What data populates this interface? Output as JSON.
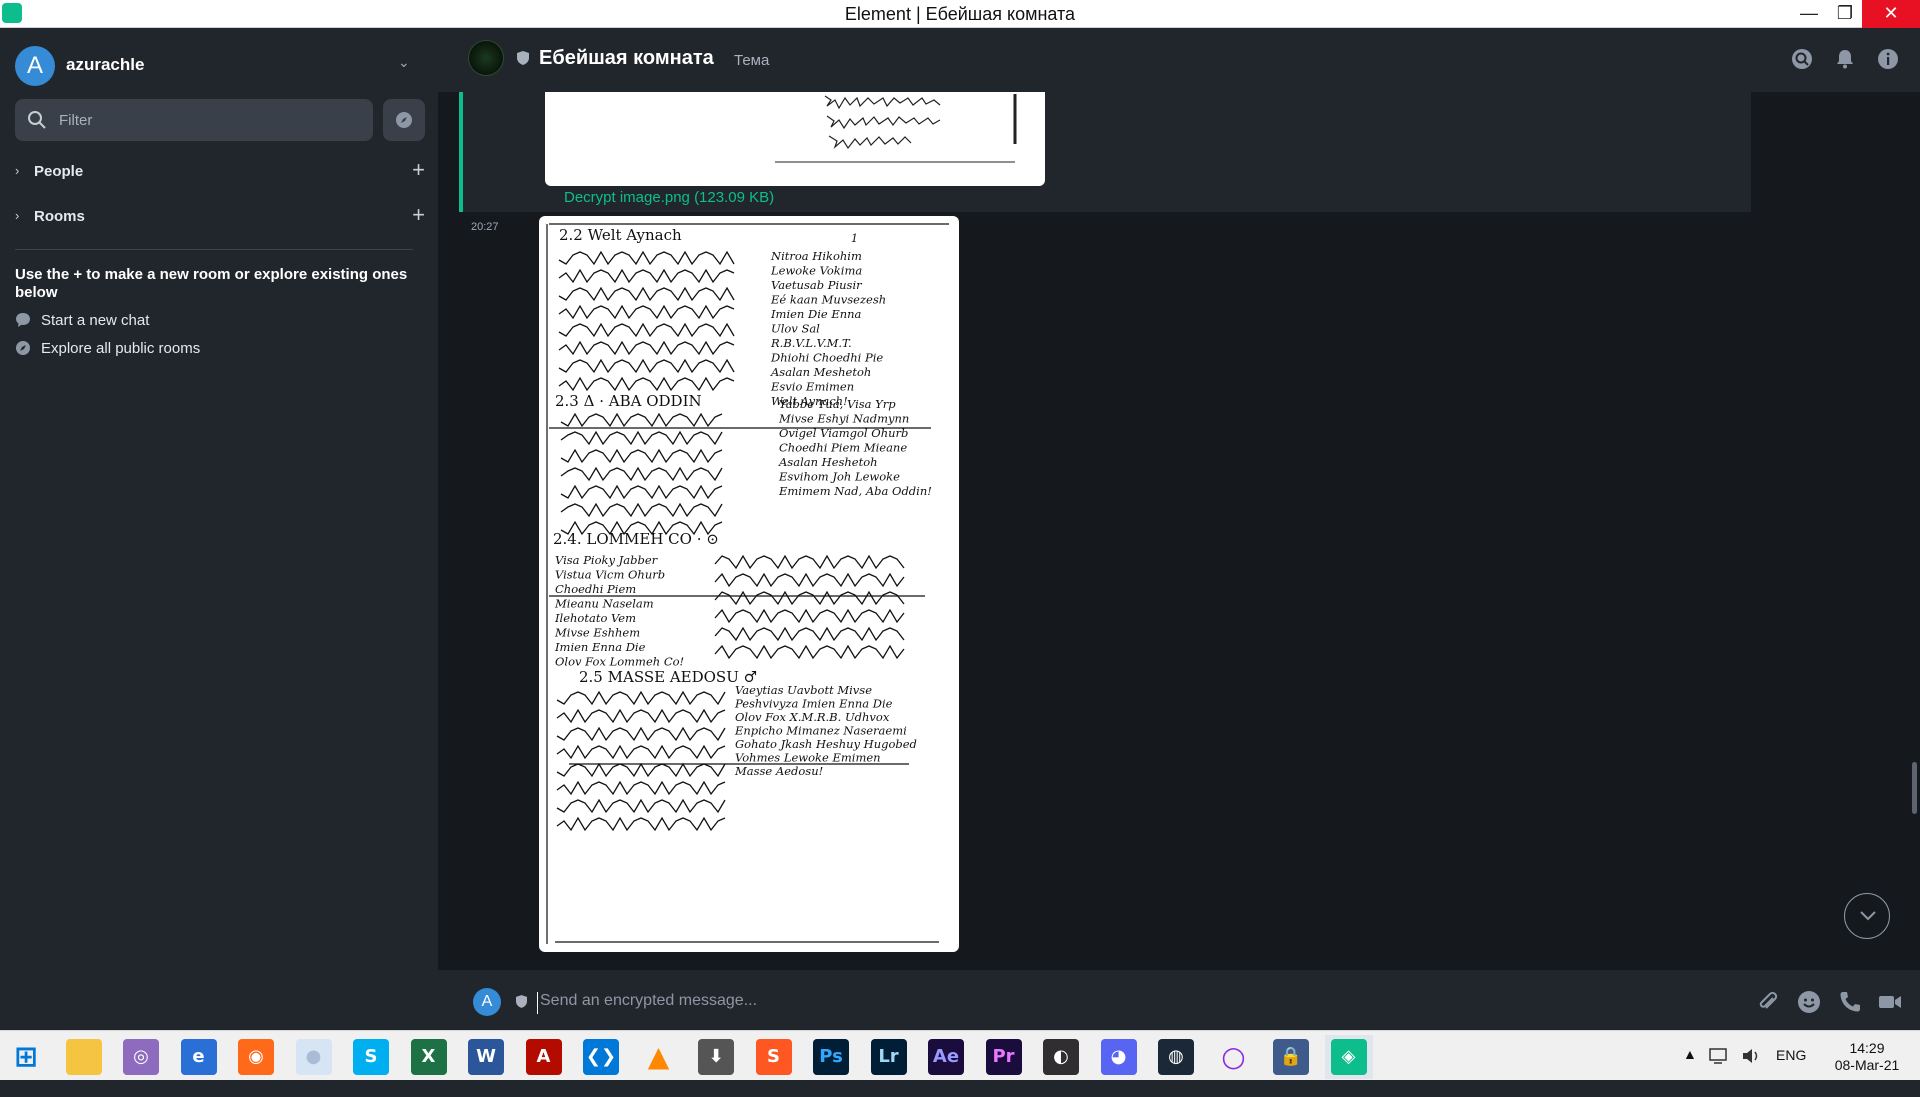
{
  "window": {
    "title": "Element | Ебейшая комната",
    "minimize": "—",
    "maximize": "❐",
    "close": "✕"
  },
  "user": {
    "initial": "A",
    "name": "azurachle",
    "avatar_color": "#368bd6"
  },
  "left_panel": {
    "filter_placeholder": "Filter",
    "sections": [
      {
        "label": "People"
      },
      {
        "label": "Rooms"
      }
    ],
    "hint": "Use the + to make a new room or explore existing ones below",
    "actions": [
      {
        "label": "Start a new chat",
        "icon": "chat-bubble-icon"
      },
      {
        "label": "Explore all public rooms",
        "icon": "compass-icon"
      }
    ]
  },
  "room": {
    "name": "Ебейшая комната",
    "topic": "Тема"
  },
  "timeline": {
    "prev_attachment_link": "Decrypt image.png (123.09 KB)",
    "event_time": "20:27",
    "document": {
      "sections": [
        {
          "heading": "2.2  Welt Aynach",
          "lines": [
            "Nitroa Hikohim",
            "Lewoke Vokima",
            "Vaetusab Piusir",
            "Eé kaan Muvsezesh",
            "Imien Die Enna",
            "Ulov Sal",
            "R.B.V.L.V.M.T.",
            "Dhiohi Choedhi Pie",
            "Asalan Meshetoh",
            "Esvio Emimen",
            "Welt Aynach!"
          ]
        },
        {
          "heading": "2.3  Δ · ABA ODDIN",
          "lines": [
            "Yabbe Tua, Visa Yrp",
            "Mivse Eshyi Nadmynn",
            "Ovigel Viamgol Ohurb",
            "Choedhi Piem Mieane",
            "Asalan Heshetoh",
            "Esvihom Joh Lewoke",
            "Emimem Nad, Aba Oddin!"
          ]
        },
        {
          "heading": "2.4.  LOMMEH CO · ⊙",
          "lines": [
            "Visa Pioky Jabber",
            "Vistua Vicm Ohurb",
            "Choedhi Piem",
            "Mieanu Naselam",
            "Ilehotato Vem",
            "Mivse Eshhem",
            "Imien Enna Die",
            "Olov Fox Lommeh Co!"
          ]
        },
        {
          "heading": "2.5  MASSE AEDOSU ♂",
          "lines": [
            "Vaeytias Uavbott Mivse",
            "Peshvivyza Imien Enna Die",
            "Olov Fox X.M.R.B. Udhvox",
            "Enpicho Mimanez Naseraemi",
            "Gohato Jkash Heshuy Hugobed",
            "Vohmes Lewoke Emimen",
            "Masse Aedosu!"
          ]
        }
      ],
      "page_number": "1"
    }
  },
  "composer": {
    "initial": "A",
    "placeholder": "Send an encrypted message..."
  },
  "taskbar": {
    "apps": [
      {
        "name": "start-button",
        "label": "⊞",
        "bg": "#f0f0f0",
        "fg": "#0078d7"
      },
      {
        "name": "file-explorer",
        "label": "▇",
        "bg": "#f5c542",
        "fg": "#f5c542"
      },
      {
        "name": "torrent",
        "label": "◎",
        "bg": "#8e6bbf",
        "fg": "#ffffff"
      },
      {
        "name": "ie-browser",
        "label": "e",
        "bg": "#2a6fd6",
        "fg": "#ffffff"
      },
      {
        "name": "firefox",
        "label": "◉",
        "bg": "#ff6a1a",
        "fg": "#ffffff"
      },
      {
        "name": "moon-app",
        "label": "●",
        "bg": "#d7e4f3",
        "fg": "#a9bcd6"
      },
      {
        "name": "skype",
        "label": "S",
        "bg": "#00aff0",
        "fg": "#ffffff"
      },
      {
        "name": "excel",
        "label": "X",
        "bg": "#1e7145",
        "fg": "#ffffff"
      },
      {
        "name": "word",
        "label": "W",
        "bg": "#2b579a",
        "fg": "#ffffff"
      },
      {
        "name": "acrobat",
        "label": "A",
        "bg": "#b30b00",
        "fg": "#ffffff"
      },
      {
        "name": "vscode",
        "label": "❮❯",
        "bg": "#0078d7",
        "fg": "#ffffff"
      },
      {
        "name": "vlc",
        "label": "▲",
        "bg": "#f0f0f0",
        "fg": "#ff8800"
      },
      {
        "name": "downloader",
        "label": "⬇",
        "bg": "#555555",
        "fg": "#ffffff"
      },
      {
        "name": "sublime",
        "label": "S",
        "bg": "#ff5722",
        "fg": "#ffffff"
      },
      {
        "name": "photoshop",
        "label": "Ps",
        "bg": "#001e36",
        "fg": "#31a8ff"
      },
      {
        "name": "lightroom",
        "label": "Lr",
        "bg": "#001e36",
        "fg": "#9fd8f5"
      },
      {
        "name": "after-effects",
        "label": "Ae",
        "bg": "#1a0c3d",
        "fg": "#9999ff"
      },
      {
        "name": "premiere",
        "label": "Pr",
        "bg": "#1a0c3d",
        "fg": "#ea77ff"
      },
      {
        "name": "obs",
        "label": "◐",
        "bg": "#302e31",
        "fg": "#ffffff"
      },
      {
        "name": "discord",
        "label": "◕",
        "bg": "#5865f2",
        "fg": "#ffffff"
      },
      {
        "name": "steam",
        "label": "◍",
        "bg": "#1b2838",
        "fg": "#ffffff"
      },
      {
        "name": "cortana",
        "label": "○",
        "bg": "#f0f0f0",
        "fg": "#8a2be2"
      },
      {
        "name": "keepass",
        "label": "🔒",
        "bg": "#3f5b8c",
        "fg": "#ffffff"
      },
      {
        "name": "element",
        "label": "◈",
        "bg": "#0dbd8b",
        "fg": "#ffffff"
      }
    ],
    "tray": {
      "chevron": "▲",
      "language": "ENG",
      "time": "14:29",
      "date": "08-Mar-21"
    }
  },
  "colors": {
    "accent": "#0dbd8b",
    "panel": "#21262c",
    "timeline": "#15191e"
  }
}
